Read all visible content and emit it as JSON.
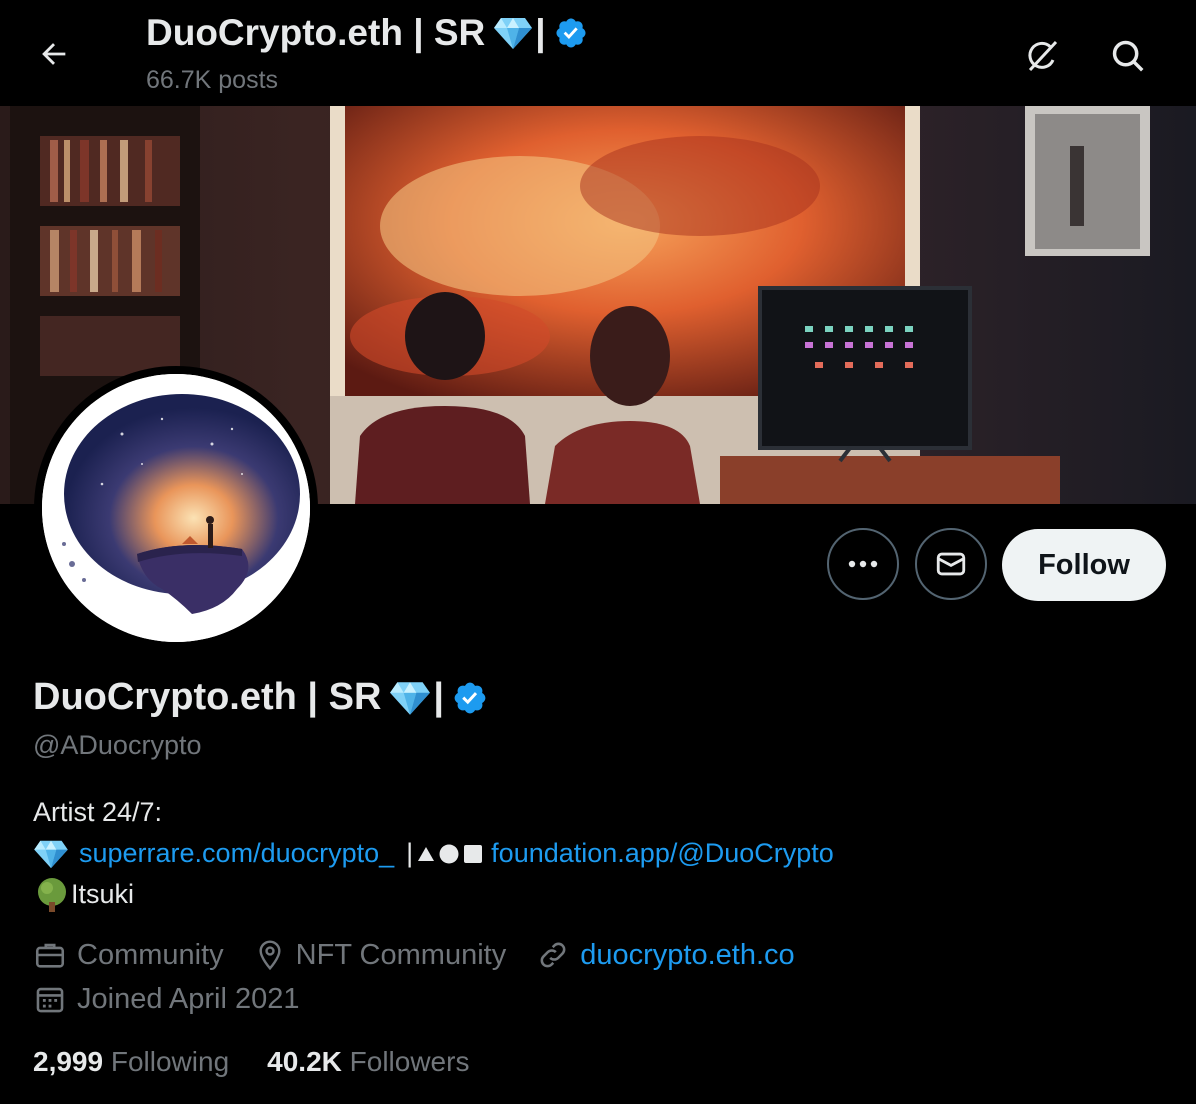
{
  "header": {
    "title": "DuoCrypto.eth | SR",
    "title_bar": "|",
    "posts": "66.7K posts"
  },
  "profile": {
    "name": "DuoCrypto.eth | SR",
    "name_bar": "|",
    "handle": "@ADuocrypto",
    "bio": {
      "line1": "Artist 24/7:",
      "link1": "superrare.com/duocrypto_",
      "separator": "|",
      "link2": "foundation.app/@DuoCrypto",
      "line3": "Itsuki"
    },
    "category": "Community",
    "location": "NFT Community",
    "website": "duocrypto.eth.co",
    "joined": "Joined April 2021",
    "following_count": "2,999",
    "following_label": "Following",
    "followers_count": "40.2K",
    "followers_label": "Followers"
  },
  "actions": {
    "follow_label": "Follow"
  },
  "icons": {
    "back": "back-arrow-icon",
    "grok": "grok-icon",
    "search": "search-icon",
    "more": "more-icon",
    "message": "mail-icon",
    "category": "briefcase-icon",
    "location": "location-pin-icon",
    "website": "link-icon",
    "joined": "calendar-icon",
    "verified": "verified-badge-icon",
    "gem": "gem-emoji",
    "tree": "tree-emoji"
  },
  "colors": {
    "background": "#000000",
    "link": "#1d9bf0",
    "secondary_text": "#71767b",
    "follow_button": "#eff3f4"
  }
}
